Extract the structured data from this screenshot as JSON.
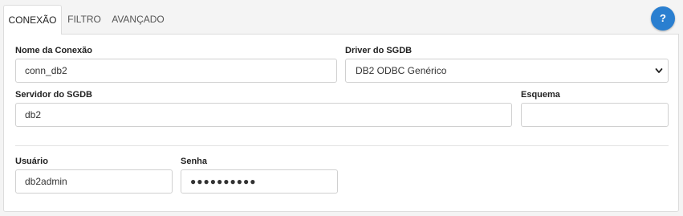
{
  "tabs": [
    {
      "label": "CONEXÃO",
      "active": true
    },
    {
      "label": "FILTRO",
      "active": false
    },
    {
      "label": "AVANÇADO",
      "active": false
    }
  ],
  "help": {
    "label": "?"
  },
  "form": {
    "connection_name": {
      "label": "Nome da Conexão",
      "value": "conn_db2"
    },
    "driver": {
      "label": "Driver do SGDB",
      "value": "DB2 ODBC Genérico"
    },
    "server": {
      "label": "Servidor do SGDB",
      "value": "db2"
    },
    "schema": {
      "label": "Esquema",
      "value": ""
    },
    "user": {
      "label": "Usuário",
      "value": "db2admin"
    },
    "password": {
      "label": "Senha",
      "value": "●●●●●●●●●●"
    }
  },
  "colors": {
    "accent": "#2a7fd0",
    "border": "#d0d0d0",
    "background": "#f4f4f4"
  },
  "icons": {
    "help": "question-mark",
    "select": "chevron-down-icon"
  }
}
